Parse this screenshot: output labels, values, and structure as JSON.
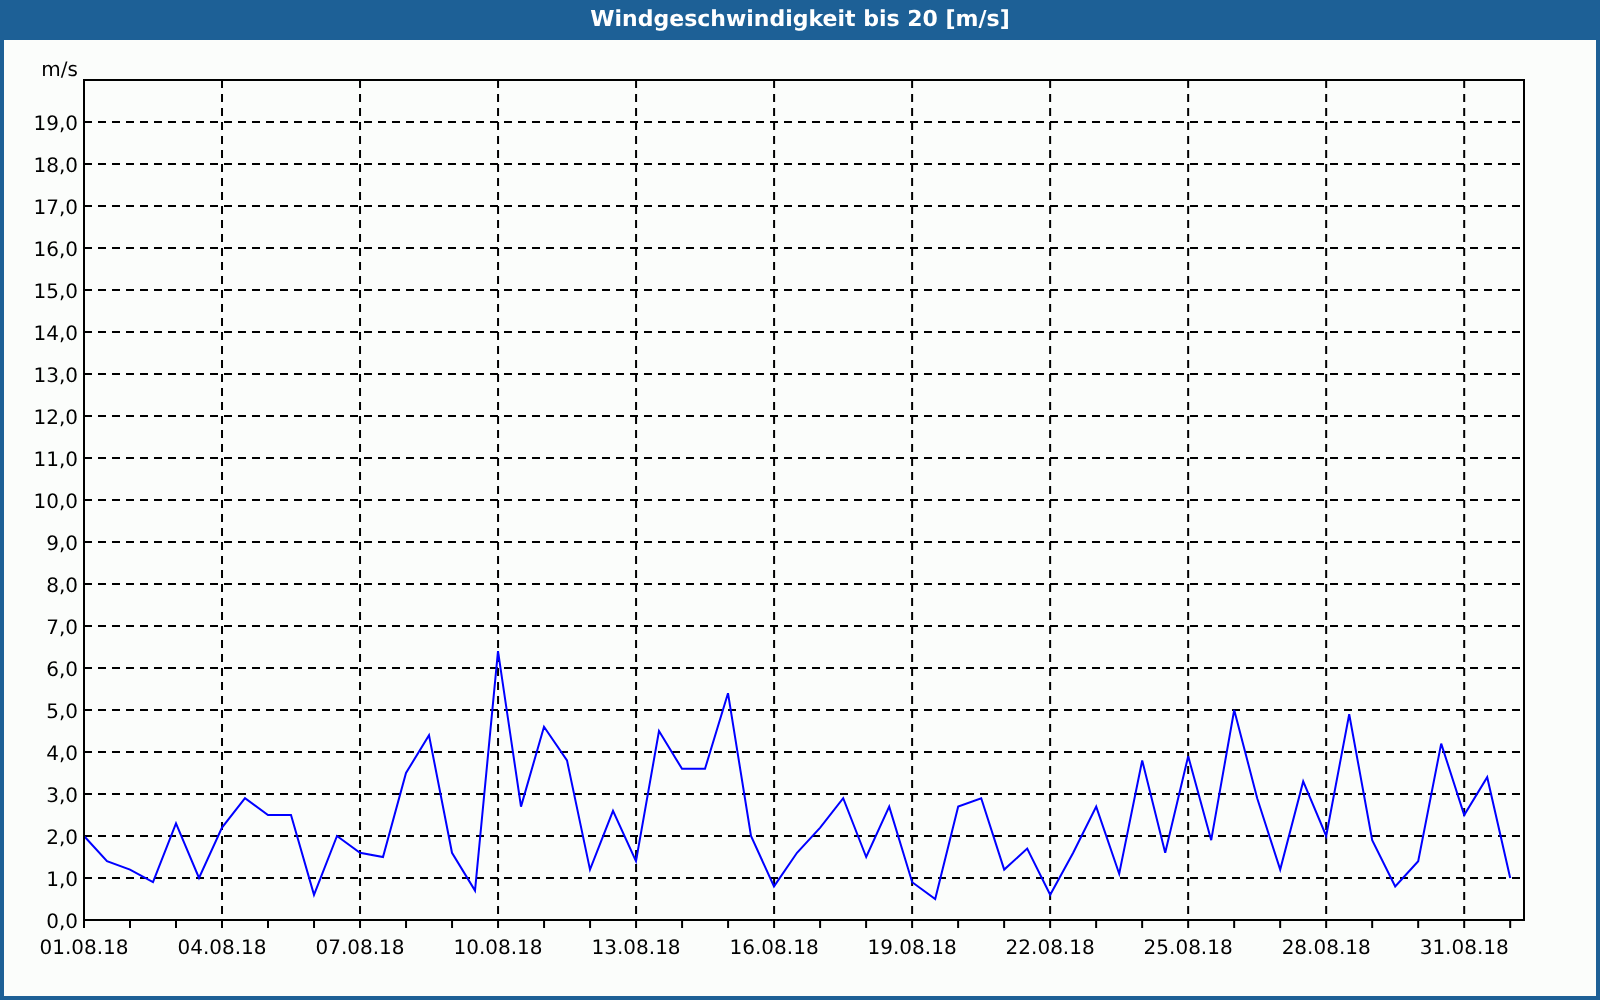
{
  "window": {
    "title": "Windgeschwindigkeit bis 20 [m/s]"
  },
  "chart": {
    "chart_data": {
      "type": "line",
      "grid": true,
      "ylabel": "m/s",
      "ylim": [
        0,
        20
      ],
      "categories": [
        "01.08.18",
        null,
        null,
        null,
        null,
        null,
        "04.08.18",
        null,
        null,
        null,
        null,
        null,
        "07.08.18",
        null,
        null,
        null,
        null,
        null,
        "10.08.18",
        null,
        null,
        null,
        null,
        null,
        "13.08.18",
        null,
        null,
        null,
        null,
        null,
        "16.08.18",
        null,
        null,
        null,
        null,
        null,
        "19.08.18",
        null,
        null,
        null,
        null,
        null,
        "22.08.18",
        null,
        null,
        null,
        null,
        null,
        "25.08.18",
        null,
        null,
        null,
        null,
        null,
        "28.08.18",
        null,
        null,
        null,
        null,
        null,
        "31.08.18",
        null,
        null
      ],
      "series": [
        {
          "color": "#0000ff",
          "values": [
            2.0,
            1.4,
            1.2,
            0.9,
            2.3,
            1.0,
            2.2,
            2.9,
            2.5,
            2.5,
            0.6,
            2.0,
            1.6,
            1.5,
            3.5,
            4.4,
            1.6,
            0.7,
            6.4,
            2.7,
            4.6,
            3.8,
            1.2,
            2.6,
            1.4,
            4.5,
            3.6,
            3.6,
            5.4,
            2.0,
            0.8,
            1.6,
            2.2,
            2.9,
            1.5,
            2.7,
            0.9,
            0.5,
            2.7,
            2.9,
            1.2,
            1.7,
            0.6,
            1.6,
            2.7,
            1.1,
            3.8,
            1.6,
            3.9,
            1.9,
            5.0,
            2.9,
            1.2,
            3.3,
            2.0,
            4.9,
            1.9,
            0.8,
            1.4,
            4.2,
            2.5,
            3.4,
            1.0
          ]
        }
      ],
      "yticks": [
        {
          "value": 0,
          "label": "0,0"
        },
        {
          "value": 1,
          "label": "1,0"
        },
        {
          "value": 2,
          "label": "2,0"
        },
        {
          "value": 3,
          "label": "3,0"
        },
        {
          "value": 4,
          "label": "4,0"
        },
        {
          "value": 5,
          "label": "5,0"
        },
        {
          "value": 6,
          "label": "6,0"
        },
        {
          "value": 7,
          "label": "7,0"
        },
        {
          "value": 8,
          "label": "8,0"
        },
        {
          "value": 9,
          "label": "9,0"
        },
        {
          "value": 10,
          "label": "10,0"
        },
        {
          "value": 11,
          "label": "11,0"
        },
        {
          "value": 12,
          "label": "12,0"
        },
        {
          "value": 13,
          "label": "13,0"
        },
        {
          "value": 14,
          "label": "14,0"
        },
        {
          "value": 15,
          "label": "15,0"
        },
        {
          "value": 16,
          "label": "16,0"
        },
        {
          "value": 17,
          "label": "17,0"
        },
        {
          "value": 18,
          "label": "18,0"
        },
        {
          "value": 19,
          "label": "19,0"
        }
      ]
    }
  }
}
